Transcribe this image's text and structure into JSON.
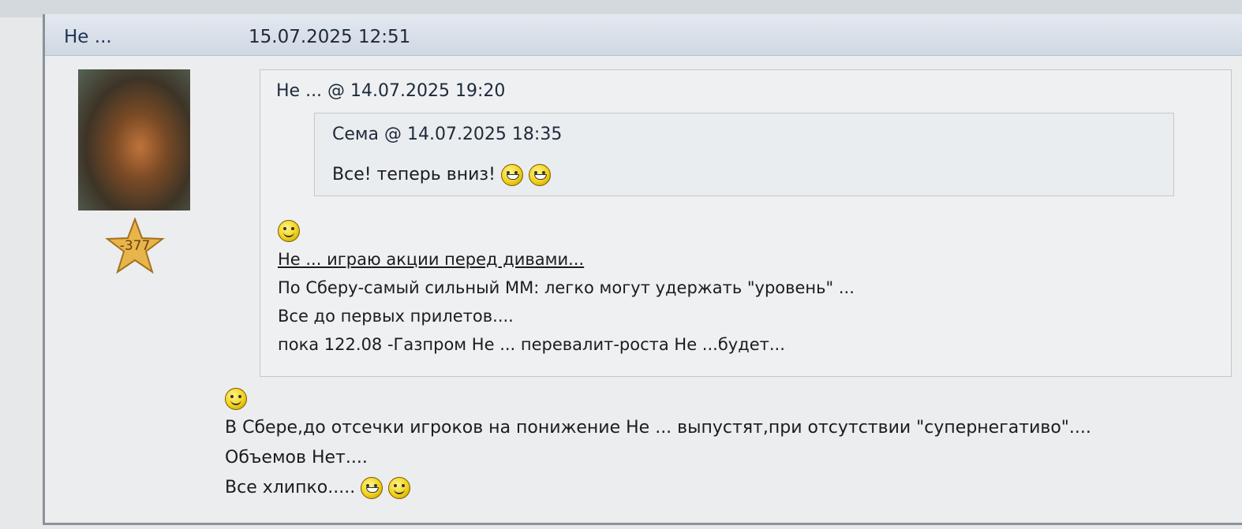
{
  "post": {
    "author": "Не ...",
    "date": "15.07.2025 12:51",
    "rank_value": "-377",
    "rank_color": "#e8b54a",
    "quote": {
      "header": "Не ... @ 14.07.2025 19:20",
      "inner_quote": {
        "header": "Сема @ 14.07.2025 18:35",
        "text": "Все! теперь вниз!",
        "icons": [
          "laughing-smiley-icon",
          "laughing-smiley-icon"
        ]
      },
      "icon": "thinking-smiley-icon",
      "lines": [
        "Не ... играю акции перед дивами...",
        "По Сберу-самый сильный ММ: легко могут удержать \"уровень\" ...",
        "Все до первых прилетов....",
        "пока 122.08 -Газпром Не ... перевалит-роста Не ...будет..."
      ]
    },
    "icon": "smiling-smiley-icon",
    "body_lines": [
      "В Сбере,до отсечки игроков на понижение Не ... выпустят,при отсутствии \"супернегативо\"....",
      "Объемов Нет....",
      "Все хлипко....."
    ],
    "end_icons": [
      "laughing-smiley-icon",
      "winking-smiley-icon"
    ]
  }
}
